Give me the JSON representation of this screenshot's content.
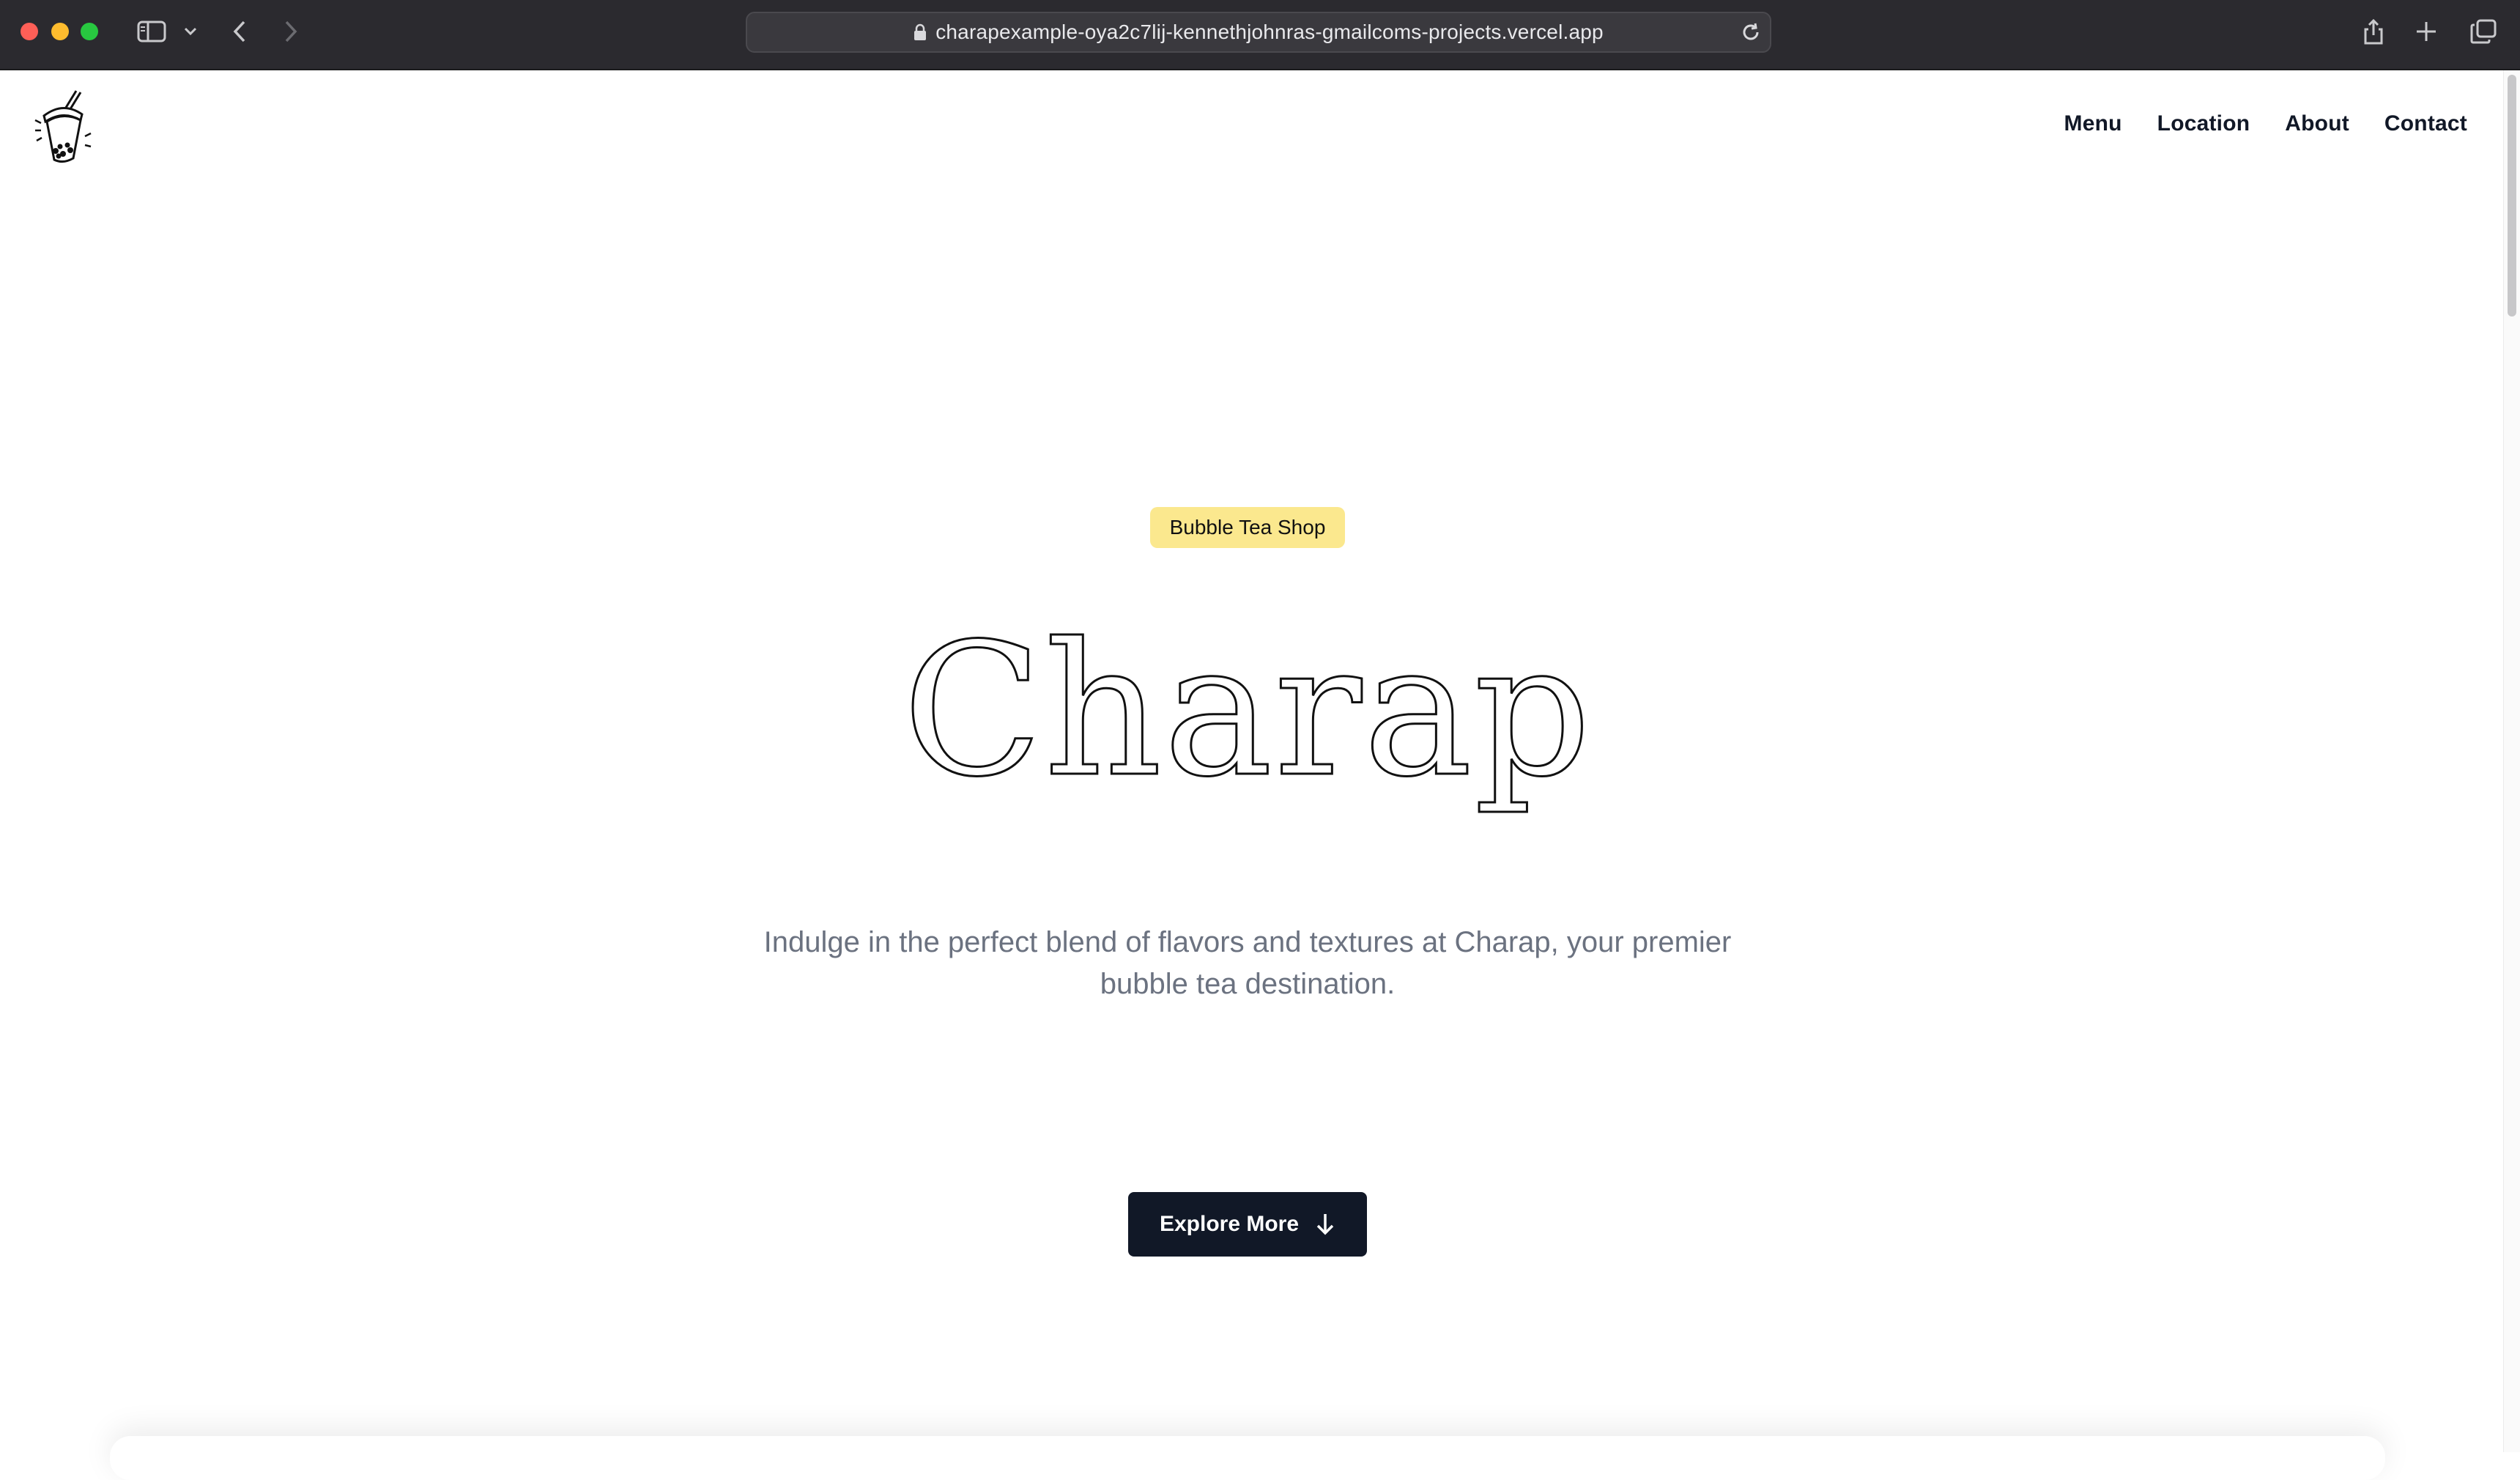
{
  "browser": {
    "url": "charapexample-oya2c7lij-kennethjohnras-gmailcoms-projects.vercel.app"
  },
  "header": {
    "logo_icon": "bubble-tea-cup-icon",
    "nav": [
      {
        "label": "Menu"
      },
      {
        "label": "Location"
      },
      {
        "label": "About"
      },
      {
        "label": "Contact"
      }
    ]
  },
  "hero": {
    "badge": "Bubble Tea Shop",
    "title": "Charap",
    "tagline": "Indulge in the perfect blend of flavors and textures at Charap, your premier bubble tea destination.",
    "cta_label": "Explore More",
    "cta_icon": "arrow-down-icon"
  },
  "colors": {
    "badge_bg": "#fbe88e",
    "cta_bg": "#111827",
    "tagline": "#6b7280",
    "chrome_bg": "#2b2a2f"
  }
}
